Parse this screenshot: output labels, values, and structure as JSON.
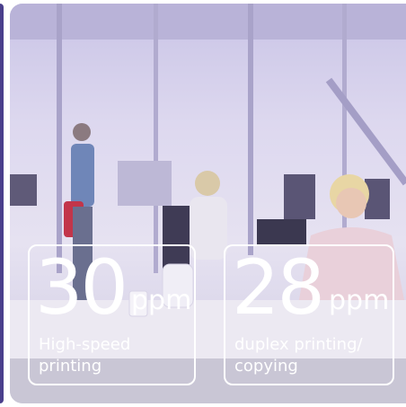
{
  "colors": {
    "accent_strip": "#4a3f8c",
    "overlay": "#c9c4e6",
    "text": "#ffffff"
  },
  "stats": [
    {
      "value": "30",
      "unit": "ppm",
      "line1": "High-speed",
      "line2": "printing"
    },
    {
      "value": "28",
      "unit": "ppm",
      "line1": "duplex printing/",
      "line2": "copying"
    }
  ]
}
